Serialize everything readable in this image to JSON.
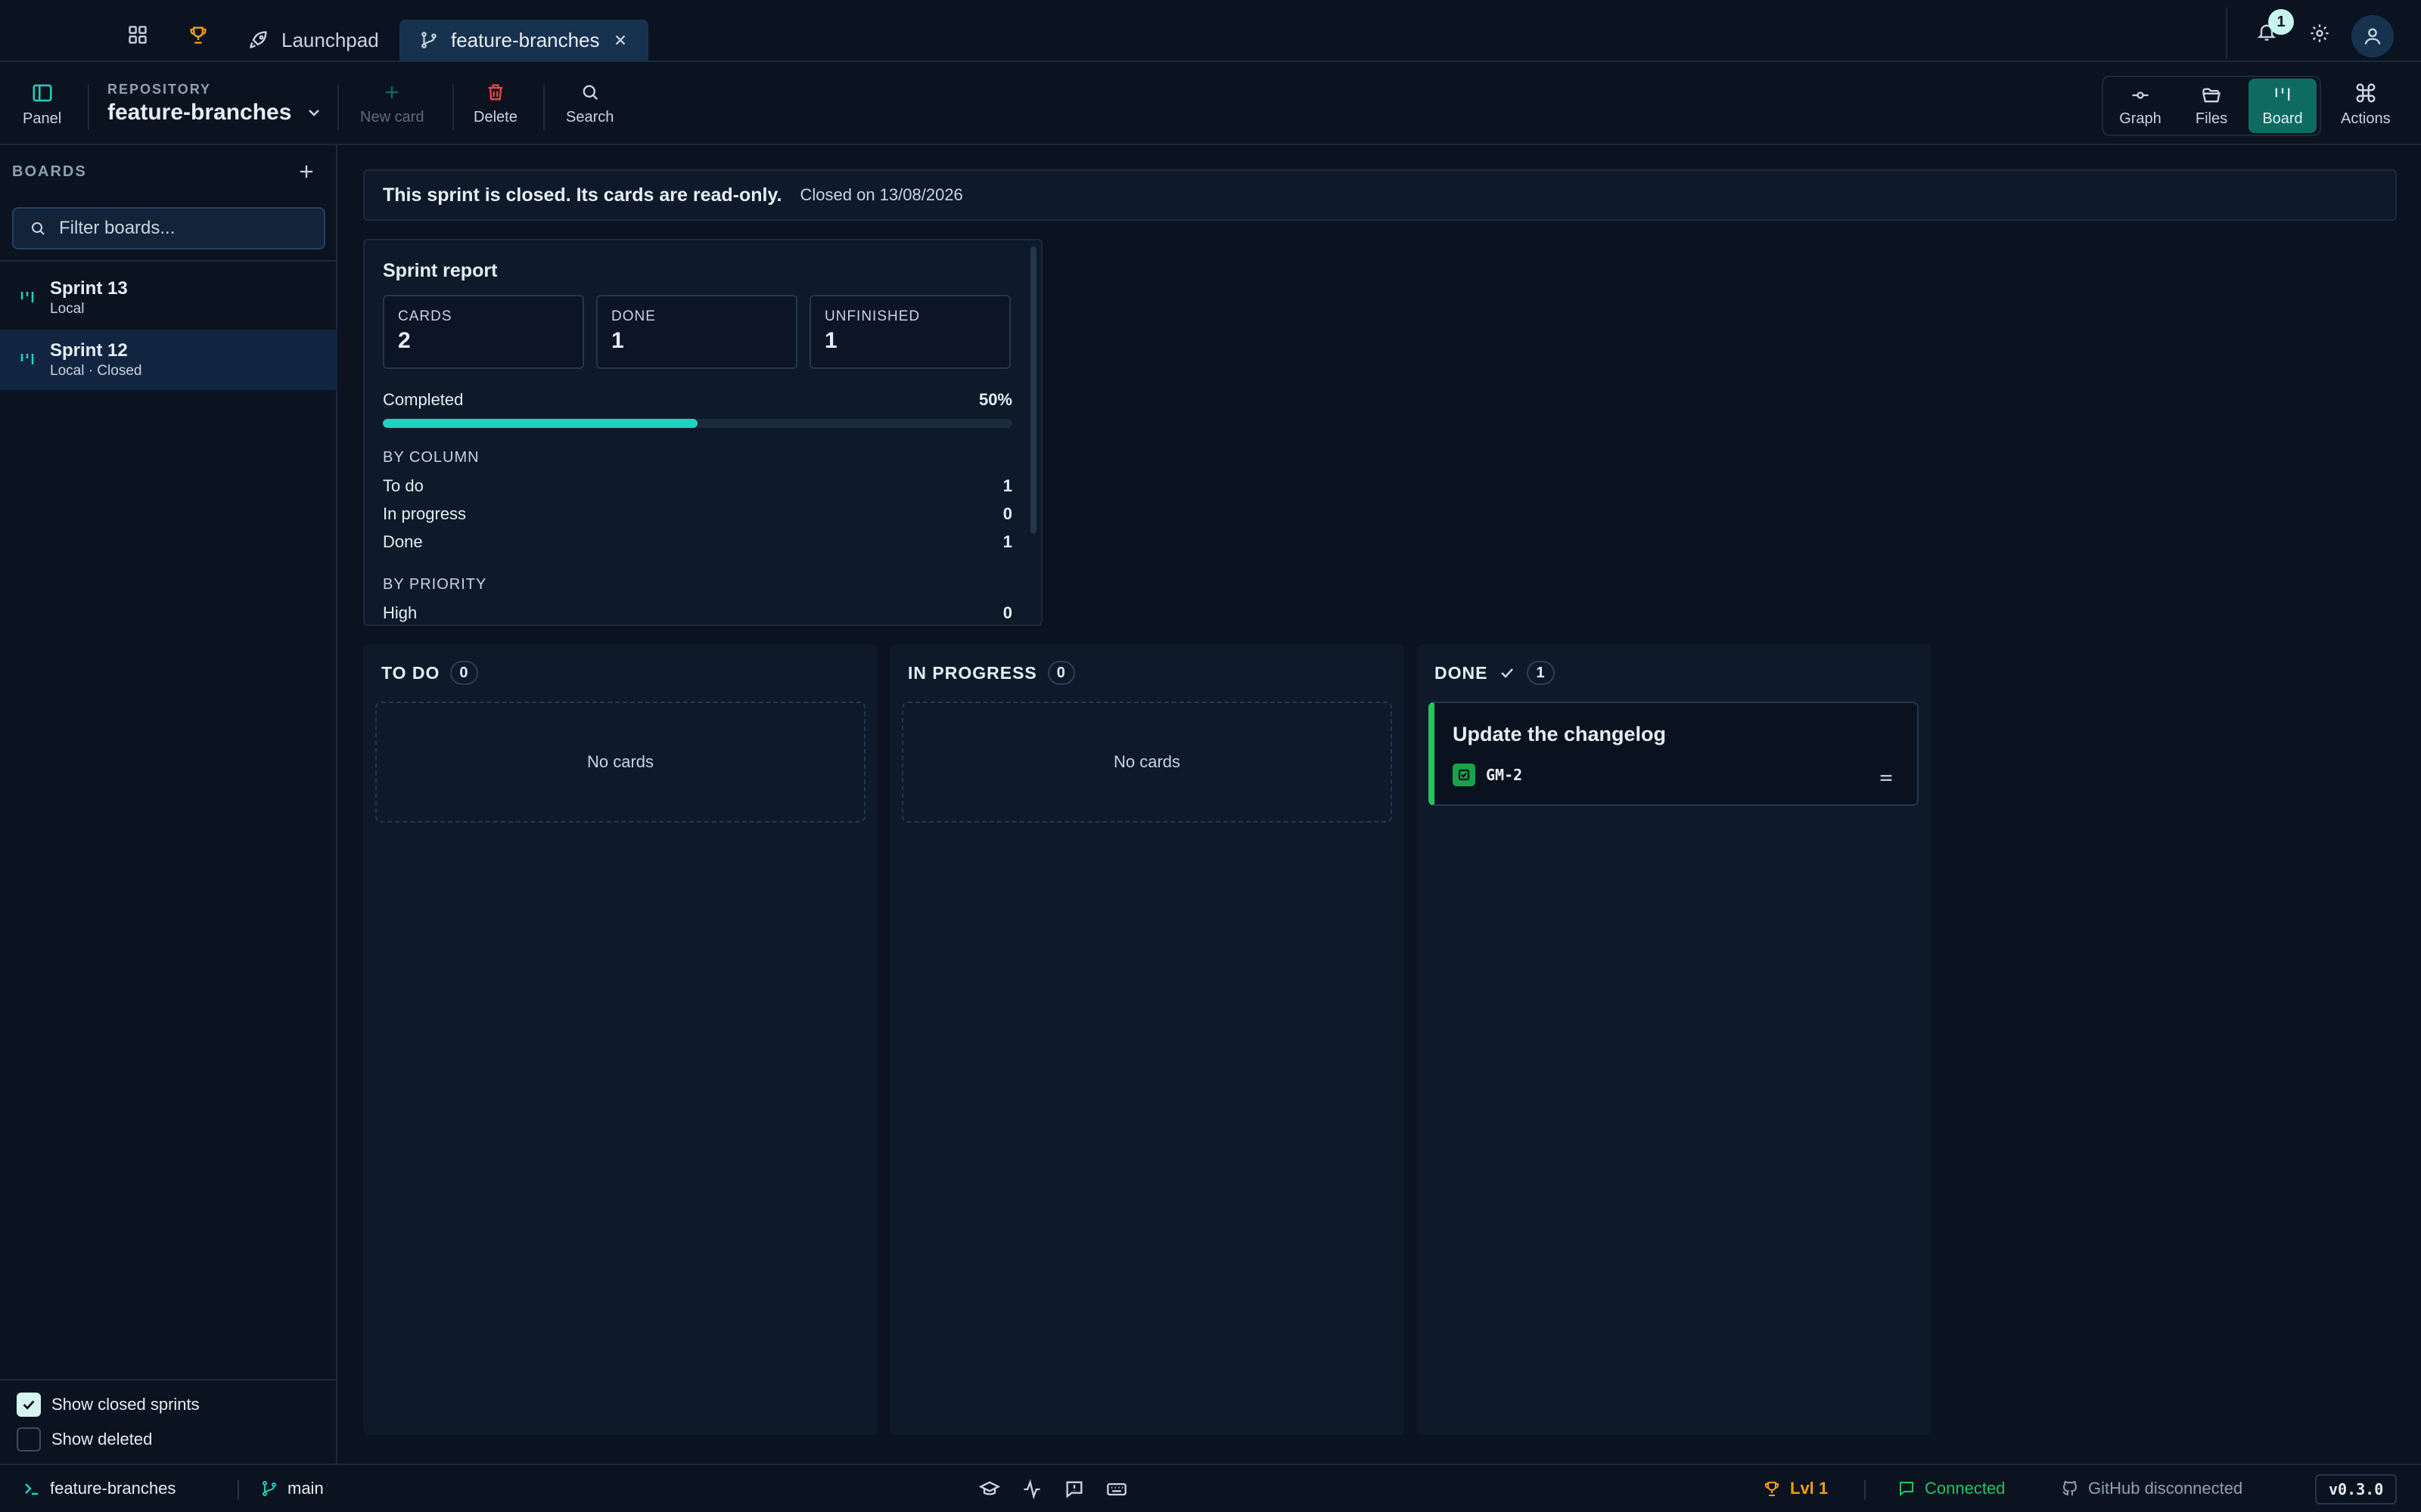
{
  "titlebar": {
    "tabs": [
      {
        "label": "Launchpad"
      },
      {
        "label": "feature-branches"
      }
    ],
    "notification_count": "1"
  },
  "toolbar": {
    "panel_label": "Panel",
    "repo_caption": "REPOSITORY",
    "repo_name": "feature-branches",
    "new_card_label": "New card",
    "delete_label": "Delete",
    "search_label": "Search",
    "views": [
      {
        "label": "Graph"
      },
      {
        "label": "Files"
      },
      {
        "label": "Board"
      }
    ],
    "actions_label": "Actions"
  },
  "sidebar": {
    "title": "BOARDS",
    "filter_placeholder": "Filter boards...",
    "boards": [
      {
        "name": "Sprint 13",
        "sub": "Local"
      },
      {
        "name": "Sprint 12",
        "sub": "Local · Closed"
      }
    ],
    "show_closed_label": "Show closed sprints",
    "show_closed_checked": true,
    "show_deleted_label": "Show deleted",
    "show_deleted_checked": false
  },
  "banner": {
    "message": "This sprint is closed. Its cards are read-only.",
    "closed_on": "Closed on 13/08/2026"
  },
  "report": {
    "title": "Sprint report",
    "stats": [
      {
        "label": "CARDS",
        "value": "2"
      },
      {
        "label": "DONE",
        "value": "1"
      },
      {
        "label": "UNFINISHED",
        "value": "1"
      }
    ],
    "completed_label": "Completed",
    "completed_pct_text": "50%",
    "completed_fraction": 0.5,
    "by_column_label": "BY COLUMN",
    "by_column": [
      {
        "name": "To do",
        "value": "1"
      },
      {
        "name": "In progress",
        "value": "0"
      },
      {
        "name": "Done",
        "value": "1"
      }
    ],
    "by_priority_label": "BY PRIORITY",
    "by_priority": [
      {
        "name": "High",
        "value": "0"
      }
    ]
  },
  "columns": [
    {
      "title": "TO DO",
      "count": "0",
      "empty_text": "No cards"
    },
    {
      "title": "IN PROGRESS",
      "count": "0",
      "empty_text": "No cards"
    },
    {
      "title": "DONE",
      "count": "1",
      "cards": [
        {
          "title": "Update the changelog",
          "key": "GM-2"
        }
      ]
    }
  ],
  "statusbar": {
    "repo": "feature-branches",
    "branch": "main",
    "level": "Lvl 1",
    "connection": "Connected",
    "github": "GitHub disconnected",
    "version": "v0.3.0"
  },
  "colors": {
    "accent": "#1fd1c1",
    "active_view": "#0e6b62",
    "done_green": "#22c55e",
    "trophy": "#f59e0b",
    "danger": "#ef4444"
  }
}
